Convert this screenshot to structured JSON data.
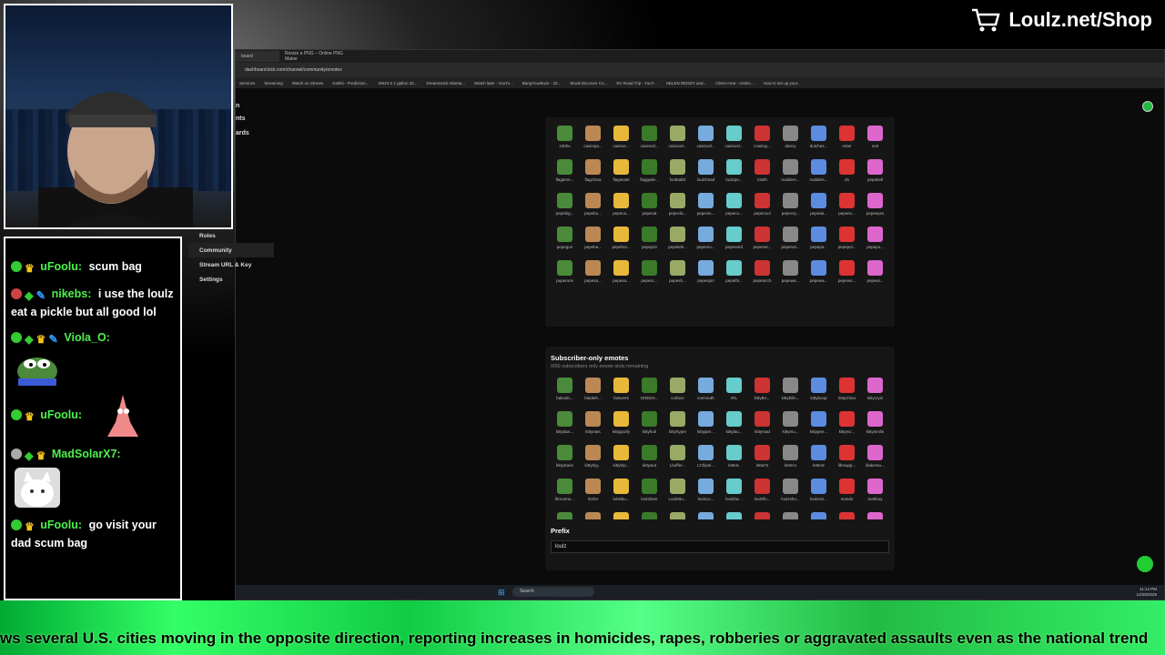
{
  "shop": {
    "label": "Loulz.net/Shop"
  },
  "chat": {
    "messages": [
      {
        "user": "uFoolu:",
        "text": "scum bag",
        "color": "#4cf24c"
      },
      {
        "user": "nikebs:",
        "text": "i use the loulz eat a pickle but all good lol",
        "color": "#4cf24c"
      },
      {
        "user": "Viola_O:",
        "text": "",
        "color": "#4cf24c"
      },
      {
        "user": "uFoolu:",
        "text": "",
        "color": "#4cf24c"
      },
      {
        "user": "MadSolarX7:",
        "text": "",
        "color": "#4cf24c"
      },
      {
        "user": "uFoolu:",
        "text": "go visit your dad scum bag",
        "color": "#4cf24c"
      }
    ]
  },
  "browser": {
    "tabs": [
      "board",
      "Resize a PNG – Online PNG Maker"
    ],
    "url": "dashboard.kick.com/channel/community/emotes",
    "bookmarks": [
      "Services",
      "Streaming",
      "Watch on Stream",
      "Kalshi - Prediction...",
      "XM43-2 1-gallon 32...",
      "DreamHack Atlanta...",
      "Watch later - YouTu...",
      "BangYourBuck - 32...",
      "Stook Discover Co...",
      "RV Road Trip - YouT...",
      "HELEN REDDY and...",
      "Client Area - AntiSc...",
      "How to set up your..."
    ]
  },
  "nav": {
    "items": [
      "n",
      "nts",
      "ards",
      "Roles",
      "Community",
      "Stream URL & Key",
      "Settings"
    ]
  },
  "emotes": {
    "channel_names": [
      "1000x",
      "casinoja...",
      "casinor...",
      "casinosl...",
      "casinosl...",
      "casinosl...",
      "casinosl...",
      "cowboy...",
      "dancy",
      "dutches...",
      "enter",
      "exit",
      "flagame...",
      "flagchina",
      "flagisrael",
      "flaggaile...",
      "footballsl",
      "loulzhead",
      "loulzpe...",
      "loloth",
      "nodders...",
      "nodders...",
      "oh",
      "pepebell",
      "pepebig...",
      "pepebu...",
      "pepeca...",
      "pepecat",
      "pepecla...",
      "pepeclo...",
      "pepeco...",
      "pepecool",
      "pepecry...",
      "pepeda...",
      "pepeex...",
      "pepeeyes",
      "pepegun",
      "pepeha...",
      "pepehot...",
      "pepejoin",
      "pepekek...",
      "pepemu...",
      "pepenerd",
      "pepener...",
      "pepenot...",
      "pepepa...",
      "pepepol...",
      "pepepu...",
      "peperuns",
      "pepesa...",
      "pepesa...",
      "pepesc...",
      "pepesh...",
      "pepespin",
      "pepethi...",
      "pepetorch",
      "pepewa...",
      "pepewa...",
      "pepews...",
      "pepewi..."
    ],
    "subscriber_title": "Subscriber-only emotes",
    "subscriber_subtitle": "0/60 subscribers only emote slots remaining",
    "sub_names": [
      "bakedn...",
      "bladeth...",
      "fastwerk",
      "GREEN...",
      "icnface",
      "icemouth",
      "IRL",
      "kittyBA...",
      "kittybilin...",
      "kittyboop",
      "kittychina",
      "kittycryin",
      "kittydan...",
      "kittyeats",
      "kittygoofy",
      "kittyhuh",
      "kittyhyper",
      "kittyjam...",
      "kittylau...",
      "kittymad",
      "kittymu...",
      "kittypee...",
      "kittyscr...",
      "kittysmilin",
      "kittystarin",
      "kittytrig...",
      "kittytrip...",
      "kittywut",
      "Lbuffer...",
      "LChipel...",
      "letterL",
      "letterO",
      "letterU",
      "letterZ",
      "lifesupp...",
      "lilakema...",
      "lltrconne...",
      "lizzler",
      "lolokbu...",
      "loulzbeer",
      "LoulzBu...",
      "loulzco...",
      "loulzfac...",
      "loulzfin...",
      "loulzsho...",
      "loulzsm...",
      "mando",
      "mahboy",
      "n8out",
      "oumbbek",
      "partydog",
      "pepsey...",
      "pepetrol...",
      "pays",
      "Powerc...",
      "speedy",
      "teamlou...",
      "TOS",
      "W",
      "WHY"
    ],
    "prefix_title": "Prefix",
    "prefix_value": "loulz"
  },
  "taskbar": {
    "search": "Search",
    "time": "11:14 PM",
    "date": "12/28/2025"
  },
  "ticker": {
    "text": "ws several U.S. cities moving in the opposite direction, reporting increases in homicides, rapes, robberies or aggravated assaults even as the national trend"
  },
  "colors": {
    "accent": "#53fc18",
    "panel": "#161616",
    "bg": "#0b0b0b"
  }
}
